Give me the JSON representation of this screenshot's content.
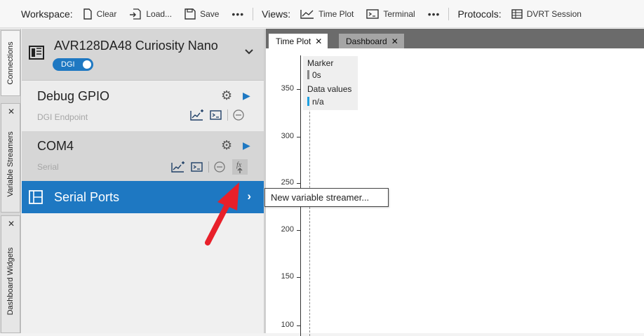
{
  "toolbar": {
    "workspace_label": "Workspace:",
    "clear": "Clear",
    "load": "Load...",
    "save": "Save",
    "more1": "•••",
    "views_label": "Views:",
    "time_plot": "Time Plot",
    "terminal": "Terminal",
    "more2": "•••",
    "protocols_label": "Protocols:",
    "dvrt_session": "DVRT Session"
  },
  "side_tabs": {
    "connections": "Connections",
    "variable_streamers": "Variable Streamers",
    "dashboard_widgets": "Dashboard Widgets",
    "close": "✕"
  },
  "device": {
    "title": "AVR128DA48 Curiosity Nano",
    "toggle_label": "DGI",
    "toggle_on": true
  },
  "endpoints": [
    {
      "title": "Debug GPIO",
      "subtitle": "DGI Endpoint"
    },
    {
      "title": "COM4",
      "subtitle": "Serial"
    }
  ],
  "serial_ports": {
    "title": "Serial Ports"
  },
  "tabs": [
    {
      "label": "Time Plot",
      "close": "✕"
    },
    {
      "label": "Dashboard",
      "close": "✕"
    }
  ],
  "plot": {
    "y_ticks": [
      "350",
      "300",
      "250",
      "200",
      "150",
      "100"
    ],
    "legend": {
      "marker_label": "Marker",
      "marker_value": "0s",
      "data_label": "Data values",
      "data_value": "n/a"
    }
  },
  "tooltip": "New variable streamer...",
  "colors": {
    "accent": "#1e78c2",
    "arrow": "#e8202a"
  }
}
